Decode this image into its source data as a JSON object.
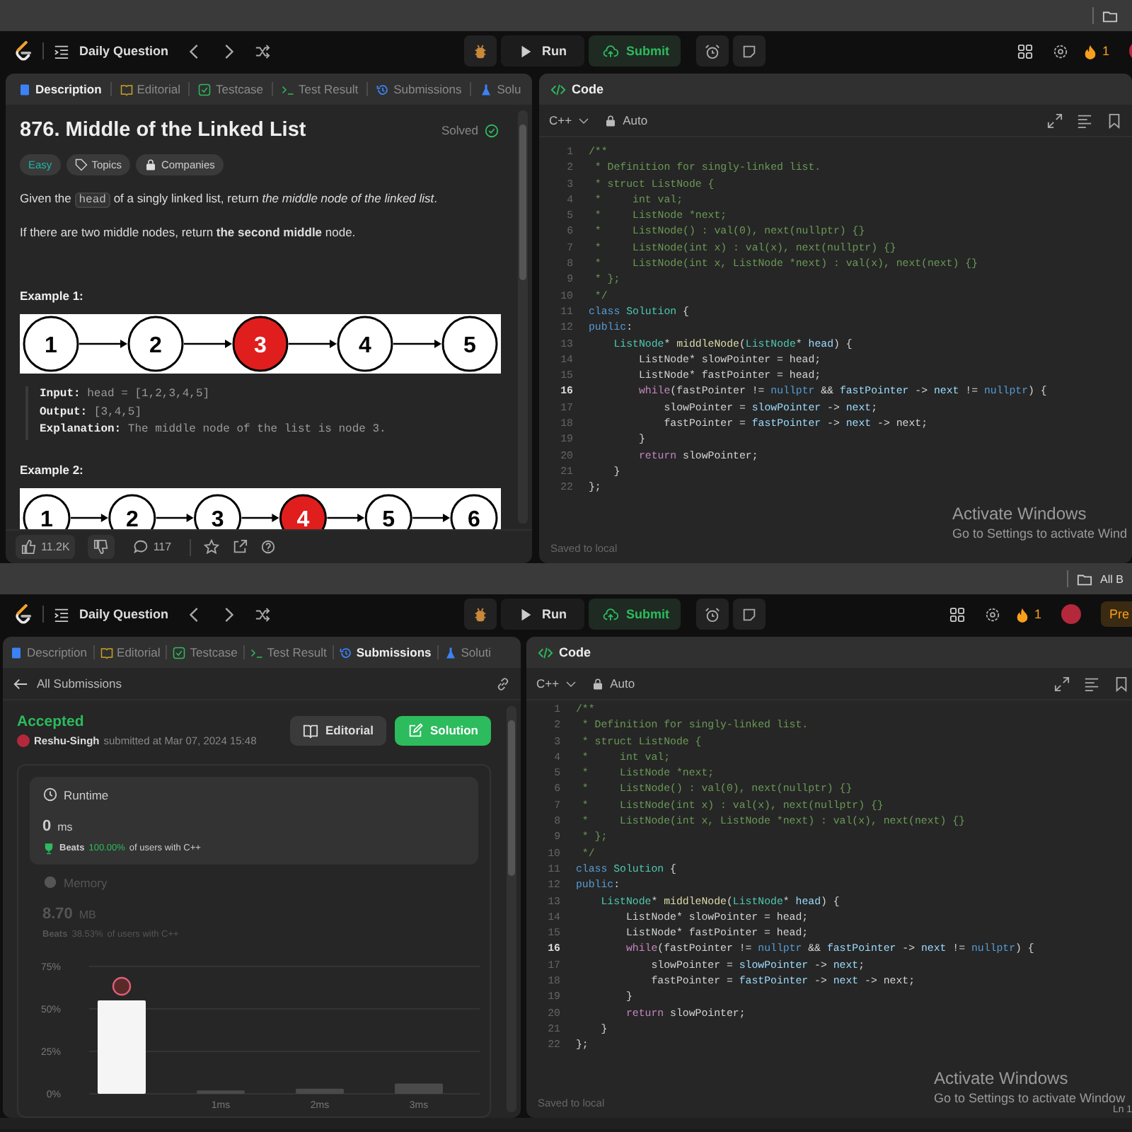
{
  "windows": [
    {
      "nav": {
        "title": "Daily Question",
        "run": "Run",
        "submit": "Submit",
        "streak": "1"
      },
      "tabs": [
        {
          "label": "Description",
          "selected": true
        },
        {
          "label": "Editorial",
          "selected": false
        },
        {
          "label": "Testcase",
          "selected": false
        },
        {
          "label": "Test Result",
          "selected": false
        },
        {
          "label": "Submissions",
          "selected": false
        },
        {
          "label": "Solu",
          "selected": false
        }
      ],
      "left": {
        "kind": "description",
        "title": "876. Middle of the Linked List",
        "status": "Solved",
        "tags": [
          {
            "label": "Easy",
            "kind": "difficulty"
          },
          {
            "label": "Topics",
            "kind": "topics"
          },
          {
            "label": "Companies",
            "kind": "companies"
          }
        ],
        "statement": {
          "before": "Given the",
          "code": "head",
          "after": "of a singly linked list, return *the middle node of the linked list*."
        },
        "note": "If there are two middle nodes, return **the second middle** node.",
        "examples": [
          {
            "title": "Example 1:",
            "nodes": [
              {
                "label": "1",
                "highlighted": false
              },
              {
                "label": "2",
                "highlighted": false
              },
              {
                "label": "3",
                "highlighted": true
              },
              {
                "label": "4",
                "highlighted": false
              },
              {
                "label": "5",
                "highlighted": false
              }
            ],
            "io": [
              {
                "label": "Input:",
                "value": "head = [1,2,3,4,5]"
              },
              {
                "label": "Output:",
                "value": "[3,4,5]"
              },
              {
                "label": "Explanation:",
                "value": "The middle node of the list is node 3."
              }
            ]
          },
          {
            "title": "Example 2:",
            "nodes": [
              {
                "label": "1",
                "highlighted": false
              },
              {
                "label": "2",
                "highlighted": false
              },
              {
                "label": "3",
                "highlighted": false
              },
              {
                "label": "4",
                "highlighted": true
              },
              {
                "label": "5",
                "highlighted": false
              },
              {
                "label": "6",
                "highlighted": false
              }
            ]
          }
        ],
        "likes": "11.2K",
        "comments": "117"
      },
      "editor": {
        "title": "Code",
        "language": "C++",
        "mode": "Auto",
        "saved": "Saved to local",
        "watermark": [
          "Activate Windows",
          "Go to Settings to activate Wind"
        ],
        "lines": [
          {
            "n": "1",
            "active": false,
            "tokens": [
              {
                "text": "/**",
                "kind": "comment"
              }
            ]
          },
          {
            "n": "2",
            "active": false,
            "tokens": [
              {
                "text": " * Definition for singly-linked list.",
                "kind": "comment"
              }
            ]
          },
          {
            "n": "3",
            "active": false,
            "tokens": [
              {
                "text": " * struct ListNode {",
                "kind": "comment"
              }
            ]
          },
          {
            "n": "4",
            "active": false,
            "tokens": [
              {
                "text": " *     int val;",
                "kind": "comment"
              }
            ]
          },
          {
            "n": "5",
            "active": false,
            "tokens": [
              {
                "text": " *     ListNode *next;",
                "kind": "comment"
              }
            ]
          },
          {
            "n": "6",
            "active": false,
            "tokens": [
              {
                "text": " *     ListNode() : val(0), next(nullptr) {}",
                "kind": "comment"
              }
            ]
          },
          {
            "n": "7",
            "active": false,
            "tokens": [
              {
                "text": " *     ListNode(int x) : val(x), next(nullptr) {}",
                "kind": "comment"
              }
            ]
          },
          {
            "n": "8",
            "active": false,
            "tokens": [
              {
                "text": " *     ListNode(int x, ListNode *next) : val(x), next(next) {}",
                "kind": "comment"
              }
            ]
          },
          {
            "n": "9",
            "active": false,
            "tokens": [
              {
                "text": " * };",
                "kind": "comment"
              }
            ]
          },
          {
            "n": "10",
            "active": false,
            "tokens": [
              {
                "text": " */",
                "kind": "comment"
              }
            ]
          },
          {
            "n": "11",
            "active": false,
            "tokens": [
              {
                "text": "class",
                "kind": "keyword"
              },
              {
                "text": " Solution",
                "kind": "type"
              },
              {
                "text": " {",
                "kind": "plain"
              }
            ]
          },
          {
            "n": "12",
            "active": false,
            "tokens": [
              {
                "text": "public",
                "kind": "keyword"
              },
              {
                "text": ":",
                "kind": "plain"
              }
            ]
          },
          {
            "n": "13",
            "active": false,
            "tokens": [
              {
                "text": "    ListNode",
                "kind": "type"
              },
              {
                "text": "* ",
                "kind": "plain"
              },
              {
                "text": "middleNode",
                "kind": "function"
              },
              {
                "text": "(",
                "kind": "plain"
              },
              {
                "text": "ListNode",
                "kind": "type"
              },
              {
                "text": "* ",
                "kind": "plain"
              },
              {
                "text": "head",
                "kind": "variable"
              },
              {
                "text": ") {",
                "kind": "plain"
              }
            ]
          },
          {
            "n": "14",
            "active": false,
            "tokens": [
              {
                "text": "        ListNode* slowPointer = head;",
                "kind": "plain"
              }
            ]
          },
          {
            "n": "15",
            "active": false,
            "tokens": [
              {
                "text": "        ListNode* fastPointer = head;",
                "kind": "plain"
              }
            ]
          },
          {
            "n": "16",
            "active": true,
            "tokens": [
              {
                "text": "        while",
                "kind": "control"
              },
              {
                "text": "(fastPointer != ",
                "kind": "plain"
              },
              {
                "text": "nullptr",
                "kind": "keyword"
              },
              {
                "text": " && ",
                "kind": "plain"
              },
              {
                "text": "fastPointer",
                "kind": "variable"
              },
              {
                "text": " -> ",
                "kind": "plain"
              },
              {
                "text": "next",
                "kind": "variable"
              },
              {
                "text": " != ",
                "kind": "plain"
              },
              {
                "text": "nullptr",
                "kind": "keyword"
              },
              {
                "text": ") {",
                "kind": "plain"
              }
            ]
          },
          {
            "n": "17",
            "active": false,
            "tokens": [
              {
                "text": "            slowPointer = ",
                "kind": "plain"
              },
              {
                "text": "slowPointer",
                "kind": "variable"
              },
              {
                "text": " -> ",
                "kind": "plain"
              },
              {
                "text": "next",
                "kind": "variable"
              },
              {
                "text": ";",
                "kind": "plain"
              }
            ]
          },
          {
            "n": "18",
            "active": false,
            "tokens": [
              {
                "text": "            fastPointer = ",
                "kind": "plain"
              },
              {
                "text": "fastPointer",
                "kind": "variable"
              },
              {
                "text": " -> ",
                "kind": "plain"
              },
              {
                "text": "next",
                "kind": "variable"
              },
              {
                "text": " -> next;",
                "kind": "plain"
              }
            ]
          },
          {
            "n": "19",
            "active": false,
            "tokens": [
              {
                "text": "        }",
                "kind": "plain"
              }
            ]
          },
          {
            "n": "20",
            "active": false,
            "tokens": [
              {
                "text": "        return",
                "kind": "control"
              },
              {
                "text": " slowPointer;",
                "kind": "plain"
              }
            ]
          },
          {
            "n": "21",
            "active": false,
            "tokens": [
              {
                "text": "    }",
                "kind": "plain"
              }
            ]
          },
          {
            "n": "22",
            "active": false,
            "tokens": [
              {
                "text": "};",
                "kind": "plain"
              }
            ]
          }
        ]
      }
    },
    {
      "bookmarks_label": "All B",
      "nav": {
        "title": "Daily Question",
        "run": "Run",
        "submit": "Submit",
        "streak": "1",
        "premium": "Pre"
      },
      "tabs": [
        {
          "label": "Description",
          "selected": false
        },
        {
          "label": "Editorial",
          "selected": false
        },
        {
          "label": "Testcase",
          "selected": false
        },
        {
          "label": "Test Result",
          "selected": false
        },
        {
          "label": "Submissions",
          "selected": true
        },
        {
          "label": "Soluti",
          "selected": false
        }
      ],
      "left": {
        "kind": "submission",
        "back": "All Submissions",
        "status": "Accepted",
        "user": "Reshu-Singh",
        "submitted": "submitted at Mar 07, 2024 15:48",
        "buttons": [
          {
            "label": "Editorial",
            "kind": "secondary"
          },
          {
            "label": "Solution",
            "kind": "primary"
          }
        ],
        "metrics": [
          {
            "label": "Runtime",
            "selected": true,
            "value": "0",
            "unit": "ms",
            "beats": "Beats",
            "percent": "100.00%",
            "caption": "of users with C++"
          },
          {
            "label": "Memory",
            "selected": false,
            "value": "8.70",
            "unit": "MB",
            "beats": "Beats",
            "percent": "38.53%",
            "caption": "of users with C++"
          }
        ],
        "chart_data": {
          "type": "bar",
          "categories": [
            null,
            "1ms",
            "2ms",
            "3ms"
          ],
          "values": [
            55,
            2,
            3,
            6
          ],
          "ylim": [
            0,
            75
          ],
          "yticks": [
            {
              "value": 0,
              "label": "0%"
            },
            {
              "value": 25,
              "label": "25%"
            },
            {
              "value": 50,
              "label": "50%"
            },
            {
              "value": 75,
              "label": "75%"
            }
          ]
        }
      },
      "editor": {
        "title": "Code",
        "language": "C++",
        "mode": "Auto",
        "saved": "Saved to local",
        "watermark": [
          "Activate Windows",
          "Go to Settings to activate Window"
        ],
        "cursor": "Ln 1",
        "lines": [
          {
            "n": "1",
            "active": false,
            "tokens": [
              {
                "text": "/**",
                "kind": "comment"
              }
            ]
          },
          {
            "n": "2",
            "active": false,
            "tokens": [
              {
                "text": " * Definition for singly-linked list.",
                "kind": "comment"
              }
            ]
          },
          {
            "n": "3",
            "active": false,
            "tokens": [
              {
                "text": " * struct ListNode {",
                "kind": "comment"
              }
            ]
          },
          {
            "n": "4",
            "active": false,
            "tokens": [
              {
                "text": " *     int val;",
                "kind": "comment"
              }
            ]
          },
          {
            "n": "5",
            "active": false,
            "tokens": [
              {
                "text": " *     ListNode *next;",
                "kind": "comment"
              }
            ]
          },
          {
            "n": "6",
            "active": false,
            "tokens": [
              {
                "text": " *     ListNode() : val(0), next(nullptr) {}",
                "kind": "comment"
              }
            ]
          },
          {
            "n": "7",
            "active": false,
            "tokens": [
              {
                "text": " *     ListNode(int x) : val(x), next(nullptr) {}",
                "kind": "comment"
              }
            ]
          },
          {
            "n": "8",
            "active": false,
            "tokens": [
              {
                "text": " *     ListNode(int x, ListNode *next) : val(x), next(next) {}",
                "kind": "comment"
              }
            ]
          },
          {
            "n": "9",
            "active": false,
            "tokens": [
              {
                "text": " * };",
                "kind": "comment"
              }
            ]
          },
          {
            "n": "10",
            "active": false,
            "tokens": [
              {
                "text": " */",
                "kind": "comment"
              }
            ]
          },
          {
            "n": "11",
            "active": false,
            "tokens": [
              {
                "text": "class",
                "kind": "keyword"
              },
              {
                "text": " Solution",
                "kind": "type"
              },
              {
                "text": " {",
                "kind": "plain"
              }
            ]
          },
          {
            "n": "12",
            "active": false,
            "tokens": [
              {
                "text": "public",
                "kind": "keyword"
              },
              {
                "text": ":",
                "kind": "plain"
              }
            ]
          },
          {
            "n": "13",
            "active": false,
            "tokens": [
              {
                "text": "    ListNode",
                "kind": "type"
              },
              {
                "text": "* ",
                "kind": "plain"
              },
              {
                "text": "middleNode",
                "kind": "function"
              },
              {
                "text": "(",
                "kind": "plain"
              },
              {
                "text": "ListNode",
                "kind": "type"
              },
              {
                "text": "* ",
                "kind": "plain"
              },
              {
                "text": "head",
                "kind": "variable"
              },
              {
                "text": ") {",
                "kind": "plain"
              }
            ]
          },
          {
            "n": "14",
            "active": false,
            "tokens": [
              {
                "text": "        ListNode* slowPointer = head;",
                "kind": "plain"
              }
            ]
          },
          {
            "n": "15",
            "active": false,
            "tokens": [
              {
                "text": "        ListNode* fastPointer = head;",
                "kind": "plain"
              }
            ]
          },
          {
            "n": "16",
            "active": true,
            "tokens": [
              {
                "text": "        while",
                "kind": "control"
              },
              {
                "text": "(fastPointer != ",
                "kind": "plain"
              },
              {
                "text": "nullptr",
                "kind": "keyword"
              },
              {
                "text": " && ",
                "kind": "plain"
              },
              {
                "text": "fastPointer",
                "kind": "variable"
              },
              {
                "text": " -> ",
                "kind": "plain"
              },
              {
                "text": "next",
                "kind": "variable"
              },
              {
                "text": " != ",
                "kind": "plain"
              },
              {
                "text": "nullptr",
                "kind": "keyword"
              },
              {
                "text": ") {",
                "kind": "plain"
              }
            ]
          },
          {
            "n": "17",
            "active": false,
            "tokens": [
              {
                "text": "            slowPointer = ",
                "kind": "plain"
              },
              {
                "text": "slowPointer",
                "kind": "variable"
              },
              {
                "text": " -> ",
                "kind": "plain"
              },
              {
                "text": "next",
                "kind": "variable"
              },
              {
                "text": ";",
                "kind": "plain"
              }
            ]
          },
          {
            "n": "18",
            "active": false,
            "tokens": [
              {
                "text": "            fastPointer = ",
                "kind": "plain"
              },
              {
                "text": "fastPointer",
                "kind": "variable"
              },
              {
                "text": " -> ",
                "kind": "plain"
              },
              {
                "text": "next",
                "kind": "variable"
              },
              {
                "text": " -> next;",
                "kind": "plain"
              }
            ]
          },
          {
            "n": "19",
            "active": false,
            "tokens": [
              {
                "text": "        }",
                "kind": "plain"
              }
            ]
          },
          {
            "n": "20",
            "active": false,
            "tokens": [
              {
                "text": "        return",
                "kind": "control"
              },
              {
                "text": " slowPointer;",
                "kind": "plain"
              }
            ]
          },
          {
            "n": "21",
            "active": false,
            "tokens": [
              {
                "text": "    }",
                "kind": "plain"
              }
            ]
          },
          {
            "n": "22",
            "active": false,
            "tokens": [
              {
                "text": "};",
                "kind": "plain"
              }
            ]
          }
        ]
      }
    }
  ]
}
